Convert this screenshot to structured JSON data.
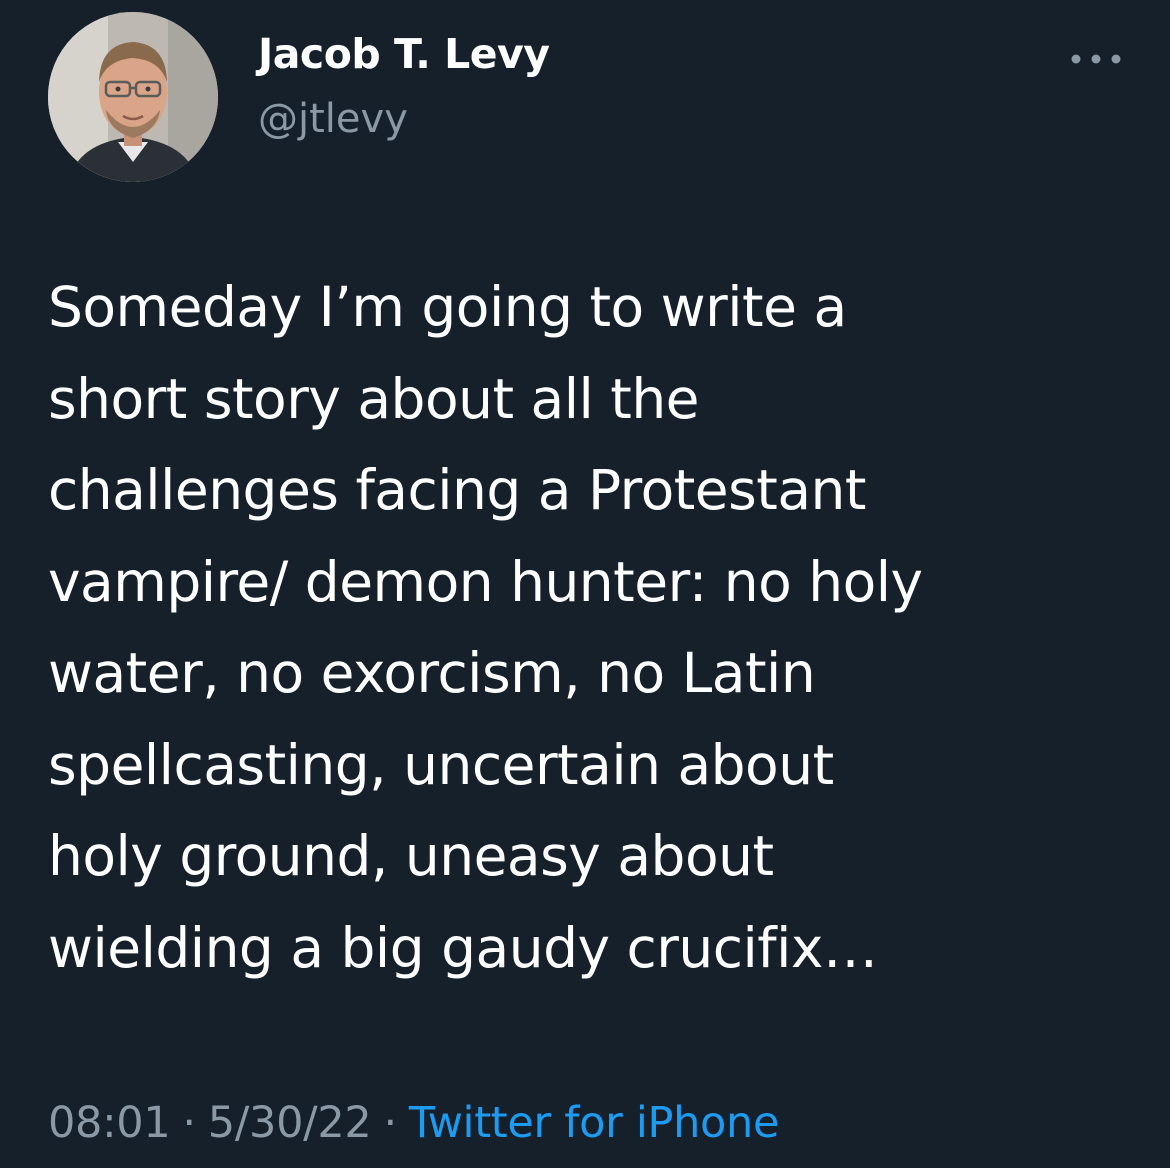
{
  "author": {
    "display_name": "Jacob T. Levy",
    "handle": "@jtlevy"
  },
  "tweet": {
    "text": "Someday I’m going to write a\nshort story about all the\nchallenges facing a Protestant\nvampire/ demon hunter: no holy\nwater, no exorcism, no Latin\nspellcasting, uncertain about\nholy ground, uneasy about\nwielding a big gaudy crucifix…",
    "time": "08:01",
    "date": "5/30/22",
    "separator": "·",
    "source": "Twitter for iPhone"
  },
  "icons": {
    "more": "more-options-icon",
    "avatar": "profile-avatar"
  },
  "colors": {
    "background": "#15202b",
    "text": "#ffffff",
    "secondary_text": "#8b98a5",
    "link": "#1d9bf0"
  }
}
